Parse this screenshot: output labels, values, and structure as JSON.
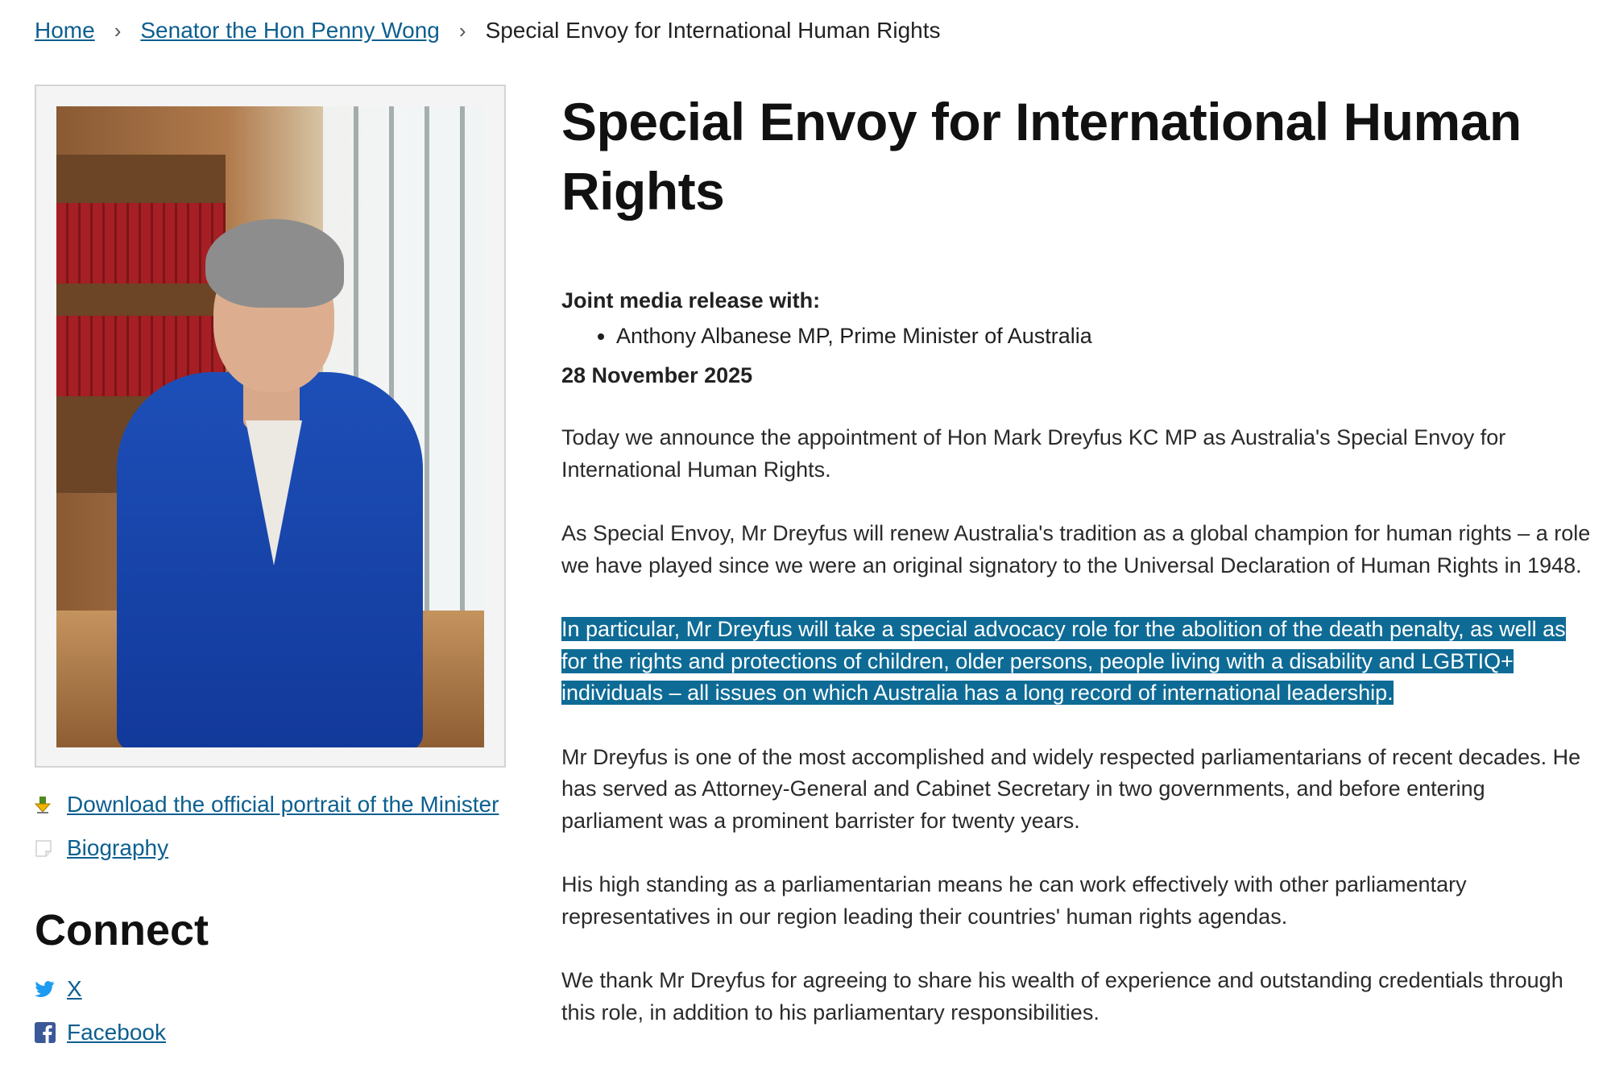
{
  "breadcrumb": {
    "home": "Home",
    "minister": "Senator the Hon Penny Wong",
    "current": "Special Envoy for International Human Rights",
    "separator": "›"
  },
  "sidebar": {
    "download_link": "Download the official portrait of the Minister",
    "biography_link": "Biography",
    "connect_heading": "Connect",
    "social": {
      "x": "X",
      "facebook": "Facebook"
    }
  },
  "article": {
    "title": "Special Envoy for International Human Rights",
    "joint_label": "Joint media release with:",
    "joint_with": [
      "Anthony Albanese MP, Prime Minister of Australia"
    ],
    "date": "28 November 2025",
    "paragraphs": [
      "Today we announce the appointment of Hon Mark Dreyfus KC MP as Australia's Special Envoy for International Human Rights.",
      "As Special Envoy, Mr Dreyfus will renew Australia's tradition as a global champion for human rights – a role we have played since we were an original signatory to the Universal Declaration of Human Rights in 1948.",
      "In particular, Mr Dreyfus will take a special advocacy role for the abolition of the death penalty, as well as for the rights and protections of children, older persons, people living with a disability and LGBTIQ+ individuals – all issues on which Australia has a long record of international leadership.",
      "Mr Dreyfus is one of the most accomplished and widely respected parliamentarians of recent decades. He has served as Attorney-General and Cabinet Secretary in two governments, and before entering parliament was a prominent barrister for twenty years.",
      "His high standing as a parliamentarian means he can work effectively with other parliamentary representatives in our region leading their countries' human rights agendas.",
      "We thank Mr Dreyfus for agreeing to share his wealth of experience and outstanding credentials through this role, in addition to his parliamentary responsibilities."
    ]
  },
  "colors": {
    "link": "#0c5f8f",
    "selection_highlight": "#0e6b95"
  }
}
